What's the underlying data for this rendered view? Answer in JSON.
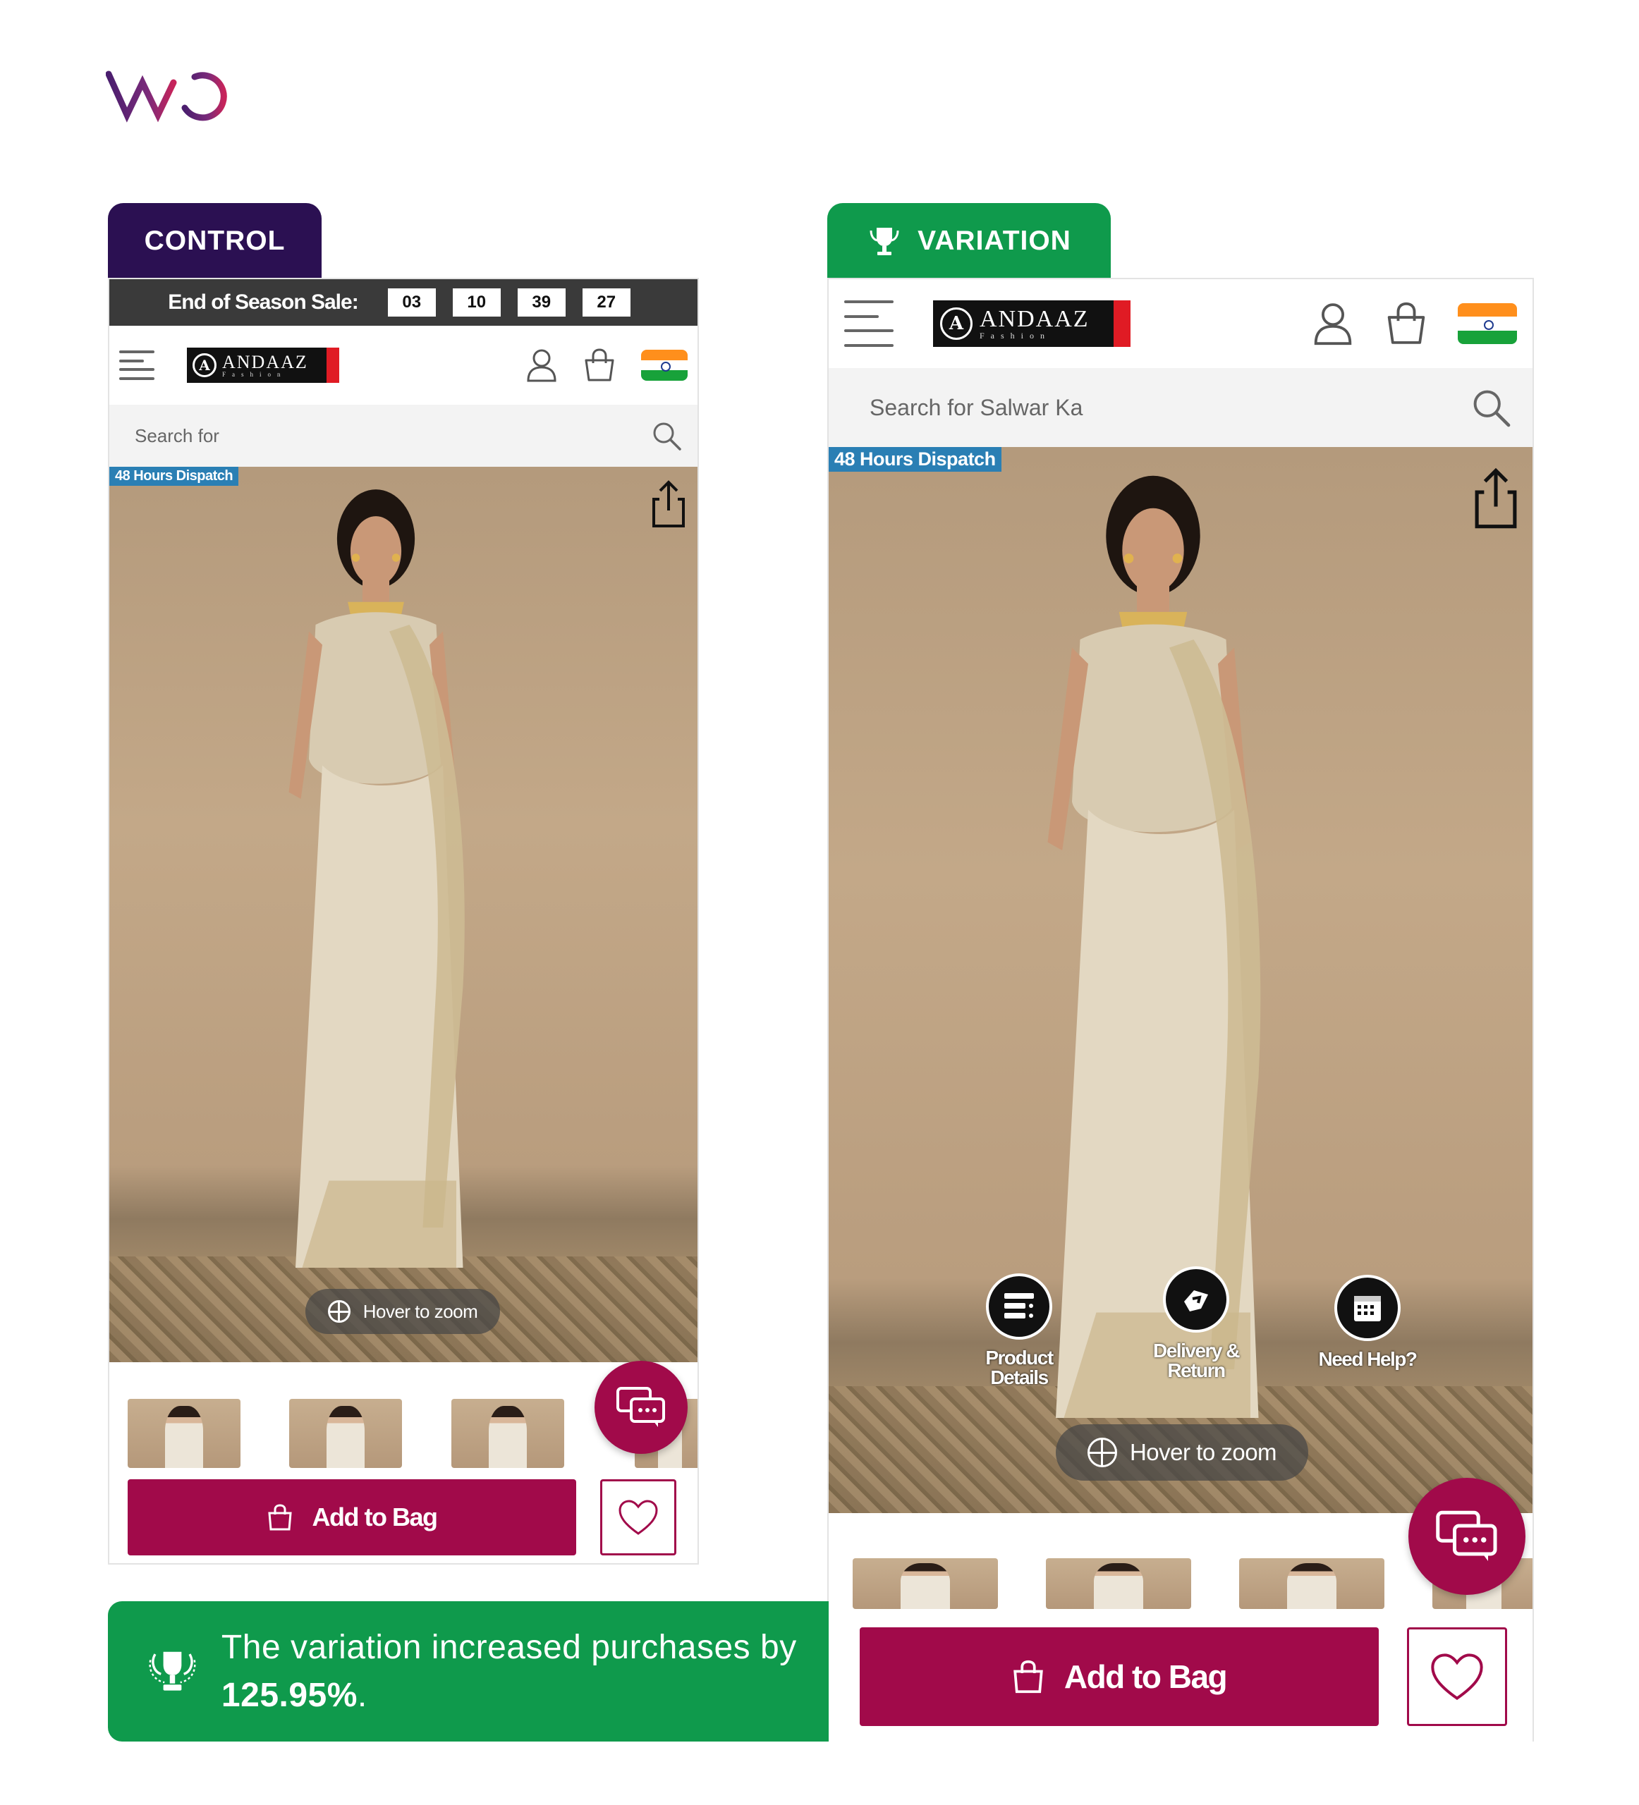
{
  "brand": {
    "name": "VWO",
    "accent": "#6e2a6e"
  },
  "control": {
    "tab_label": "CONTROL",
    "tab_color": "#2b1052",
    "sale": {
      "label": "End of Season Sale:",
      "timer": [
        "03",
        "10",
        "39",
        "27"
      ]
    },
    "logo": {
      "name": "ANDAAZ",
      "sub": "Fashion"
    },
    "search": {
      "placeholder": "Search for"
    },
    "badge": "48 Hours Dispatch",
    "zoom": "Hover to zoom",
    "cta": {
      "add_to_bag": "Add to Bag"
    }
  },
  "variation": {
    "tab_label": "VARIATION",
    "tab_color": "#0f9a4c",
    "logo": {
      "name": "ANDAAZ",
      "sub": "Fashion"
    },
    "search": {
      "placeholder": "Search for Salwar Ka"
    },
    "badge": "48 Hours Dispatch",
    "zoom": "Hover to zoom",
    "quick_links": [
      {
        "label": "Product Details",
        "icon": "list-icon"
      },
      {
        "label": "Delivery & Return",
        "icon": "delivery-icon"
      },
      {
        "label": "Need Help?",
        "icon": "help-calendar-icon"
      }
    ],
    "cta": {
      "add_to_bag": "Add to Bag"
    }
  },
  "result": {
    "text_prefix": "The variation increased purchases by ",
    "value": "125.95%",
    "text_suffix": "."
  },
  "colors": {
    "primary_cta": "#a10a4a",
    "badge_blue": "#2a7fb4",
    "success_green": "#0f9a4c"
  }
}
